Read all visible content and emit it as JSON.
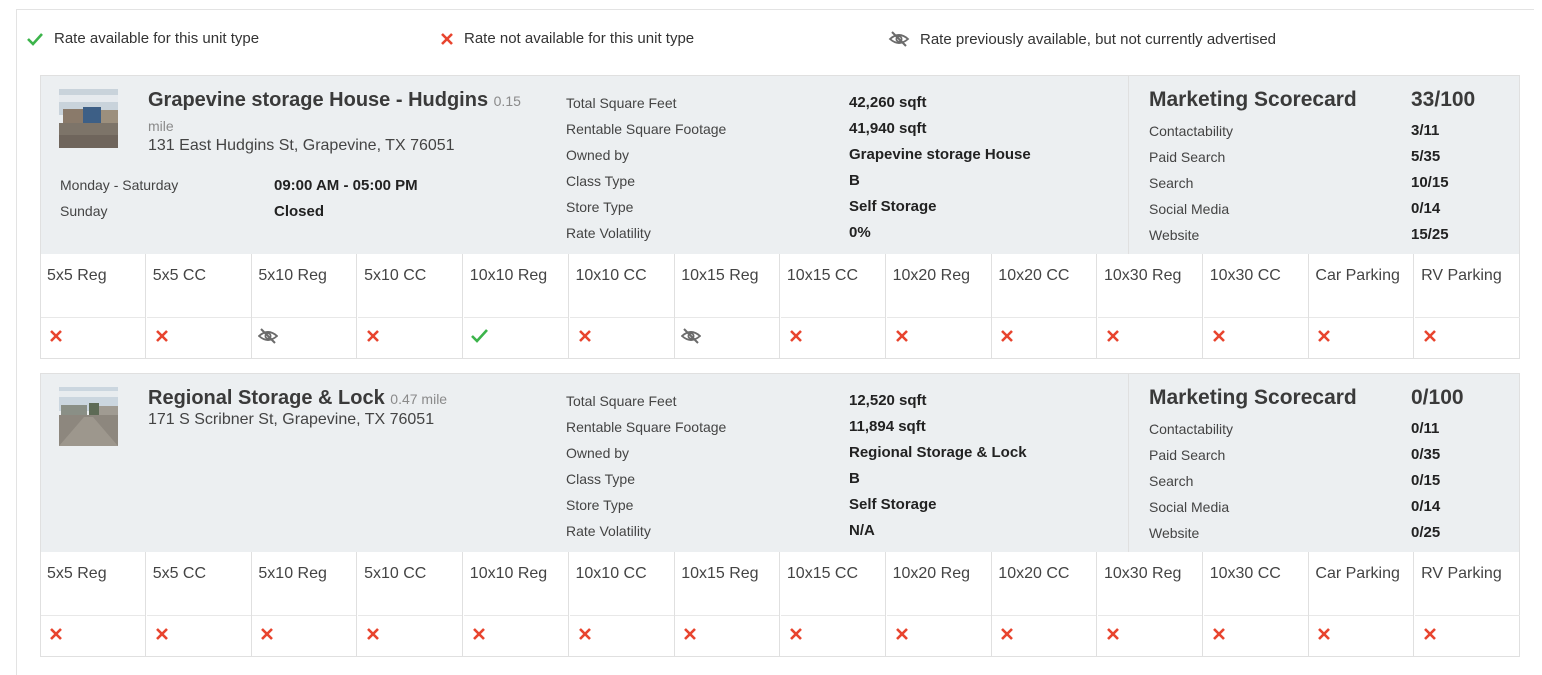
{
  "legend": {
    "available": "Rate available for this unit type",
    "not_available": "Rate not available for this unit type",
    "previously_available": "Rate previously available, but not currently advertised"
  },
  "colors": {
    "available": "#3cb44b",
    "not_available": "#e8442e",
    "previous": "#6b6b6b"
  },
  "unit_types": [
    "5x5 Reg",
    "5x5 CC",
    "5x10 Reg",
    "5x10 CC",
    "10x10 Reg",
    "10x10 CC",
    "10x15 Reg",
    "10x15 CC",
    "10x20 Reg",
    "10x20 CC",
    "10x30 Reg",
    "10x30 CC",
    "Car Parking",
    "RV Parking"
  ],
  "stores": [
    {
      "name": "Grapevine storage House - Hudgins",
      "distance": "0.15 mile",
      "address": "131 East Hudgins St, Grapevine, TX 76051",
      "hours": [
        {
          "day": "Monday - Saturday",
          "time": "09:00 AM - 05:00 PM"
        },
        {
          "day": "Sunday",
          "time": "Closed"
        }
      ],
      "info": [
        {
          "label": "Total Square Feet",
          "value": "42,260 sqft"
        },
        {
          "label": "Rentable Square Footage",
          "value": "41,940 sqft"
        },
        {
          "label": "Owned by",
          "value": "Grapevine storage House"
        },
        {
          "label": "Class Type",
          "value": "B"
        },
        {
          "label": "Store Type",
          "value": "Self Storage"
        },
        {
          "label": "Rate Volatility",
          "value": "0%"
        }
      ],
      "scorecard": {
        "title": "Marketing Scorecard",
        "total": "33/100",
        "items": [
          {
            "label": "Contactability",
            "value": "3/11"
          },
          {
            "label": "Paid Search",
            "value": "5/35"
          },
          {
            "label": "Search",
            "value": "10/15"
          },
          {
            "label": "Social Media",
            "value": "0/14"
          },
          {
            "label": "Website",
            "value": "15/25"
          }
        ]
      },
      "rates": [
        "not_available",
        "not_available",
        "previous",
        "not_available",
        "available",
        "not_available",
        "previous",
        "not_available",
        "not_available",
        "not_available",
        "not_available",
        "not_available",
        "not_available",
        "not_available"
      ]
    },
    {
      "name": "Regional Storage & Lock",
      "distance": "0.47 mile",
      "address": "171 S Scribner St, Grapevine, TX 76051",
      "hours": [],
      "info": [
        {
          "label": "Total Square Feet",
          "value": "12,520 sqft"
        },
        {
          "label": "Rentable Square Footage",
          "value": "11,894 sqft"
        },
        {
          "label": "Owned by",
          "value": "Regional Storage & Lock"
        },
        {
          "label": "Class Type",
          "value": "B"
        },
        {
          "label": "Store Type",
          "value": "Self Storage"
        },
        {
          "label": "Rate Volatility",
          "value": "N/A"
        }
      ],
      "scorecard": {
        "title": "Marketing Scorecard",
        "total": "0/100",
        "items": [
          {
            "label": "Contactability",
            "value": "0/11"
          },
          {
            "label": "Paid Search",
            "value": "0/35"
          },
          {
            "label": "Search",
            "value": "0/15"
          },
          {
            "label": "Social Media",
            "value": "0/14"
          },
          {
            "label": "Website",
            "value": "0/25"
          }
        ]
      },
      "rates": [
        "not_available",
        "not_available",
        "not_available",
        "not_available",
        "not_available",
        "not_available",
        "not_available",
        "not_available",
        "not_available",
        "not_available",
        "not_available",
        "not_available",
        "not_available",
        "not_available"
      ]
    }
  ]
}
